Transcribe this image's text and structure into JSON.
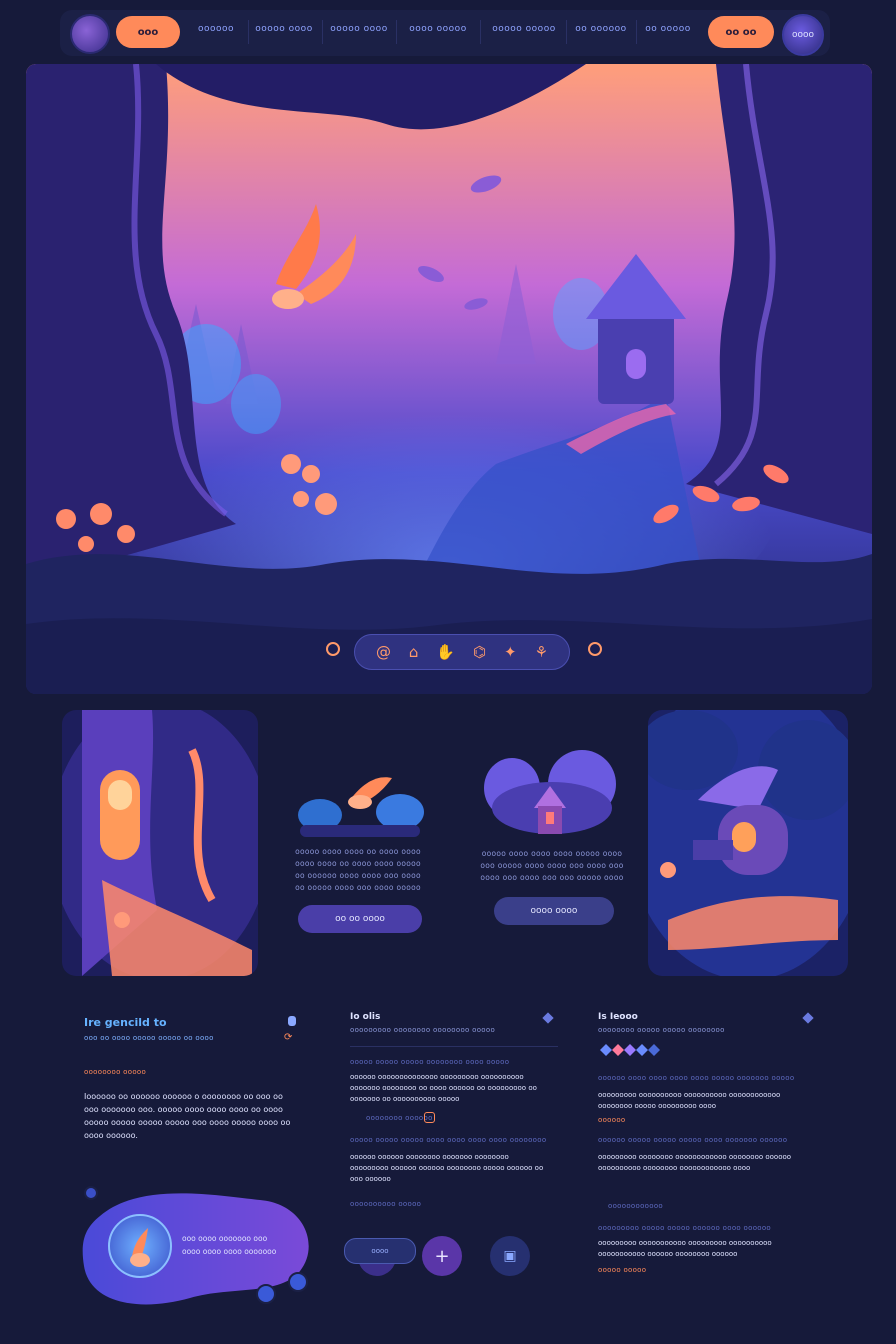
{
  "nav": {
    "cta_left": "ooo",
    "cta_right": "oo oo",
    "avatar_label": "oooo",
    "links": [
      "oooooo",
      "ooooo oooo",
      "ooooo oooo",
      "oooo ooooo",
      "ooooo ooooo",
      "oo oooooo",
      "oo ooooo"
    ]
  },
  "hero": {
    "toolbar_icons": [
      "@",
      "⌂",
      "✋",
      "⌬",
      "✦",
      "⚘"
    ]
  },
  "cards": {
    "middle_left": {
      "text": "ooooo oooo oooo oo oooo oooo oooo oooo oo oooo oooo ooooo oo oooooo oooo oooo ooo oooo oo ooooo oooo ooo oooo ooooo",
      "button": "oo oo oooo"
    },
    "middle_right": {
      "text": "ooooo oooo oooo oooo ooooo oooo ooo ooooo oooo oooo ooo oooo ooo oooo ooo oooo ooo ooo ooooo oooo",
      "button": "oooo oooo"
    }
  },
  "footer": {
    "col1": {
      "title": "Ire gencild to",
      "subtitle": "ooo oo oooo ooooo ooooo oo oooo",
      "tag": "oooooooo ooooo",
      "body": "Ioooooo oo oooooo oooooo o oooooooo oo ooo oo ooo ooooooo ooo. ooooo oooo oooo oooo oo oooo ooooo ooooo ooooo ooooo ooo oooo ooooo oooo oo oooo oooooo."
    },
    "col2": {
      "title": "Io olis",
      "subtitle": "ooooooooo oooooooo oooooooo ooooo",
      "link1": "ooooo ooooo ooooo oooooooo oooo ooooo",
      "body1": "oooooo oooooooooooooo ooooooooo oooooooooo ooooooo oooooooo oo oooo oooooo oo ooooooooo oo ooooooo oo oooooooooo ooooo",
      "link2": "oooooooo oooooo",
      "link3": "ooooo ooooo ooooo oooo oooo oooo oooo oooooooo",
      "body2": "oooooo oooooo oooooooo ooooooo oooooooo ooooooooo oooooo oooooo oooooooo ooooo oooooo oo ooo oooooo",
      "link4": "oooooooooo ooooo"
    },
    "col3": {
      "title": "Is Ieooo",
      "subtitle": "oooooooo ooooo ooooo oooooooo",
      "link1": "oooooo oooo oooo oooo oooo ooooo ooooooo ooooo",
      "body1": "ooooooooo oooooooooo oooooooooo oooooooooooo oooooooo ooooo ooooooooo oooo",
      "link2": "oooooo",
      "link3": "oooooo ooooo ooooo ooooo oooo ooooooo oooooo",
      "body2": "ooooooooo oooooooo oooooooooooo oooooooo oooooo oooooooooo oooooooo oooooooooooo oooo",
      "link4": "oooooooooooo",
      "link5": "ooooooooo ooooo ooooo oooooo oooo oooooo",
      "body3": "ooooooooo ooooooooooo ooooooooo oooooooooo ooooooooooo oooooo oooooooo oooooo",
      "link6": "ooooo ooooo"
    },
    "promo": {
      "text": "ooo oooo ooooooo ooo oooo oooo oooo ooooooo"
    },
    "actions": {
      "chip": "oooo",
      "plus": "+",
      "square": "▣"
    }
  },
  "colors": {
    "bg": "#161a3a",
    "accent": "#ff8a5a",
    "link": "#66b2ff",
    "purple": "#4a3ea8"
  }
}
